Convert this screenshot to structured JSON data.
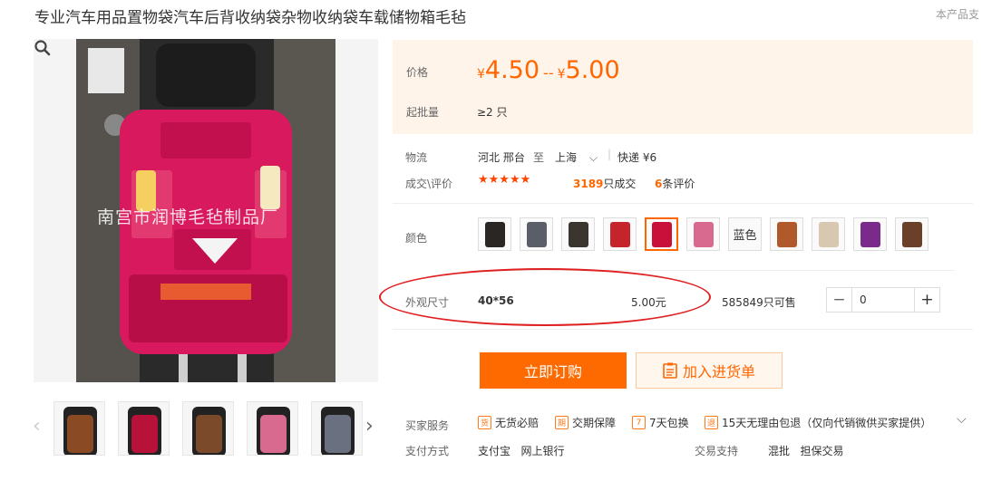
{
  "title": "专业汽车用品置物袋汽车后背收纳袋杂物收纳袋车载储物箱毛毡",
  "top_right_text": "本产品支",
  "main_image": {
    "watermark": "南宫市润博毛毡制品厂"
  },
  "price": {
    "label": "价格",
    "currency": "¥",
    "low": "4.50",
    "separator": "--",
    "high": "5.00"
  },
  "moq": {
    "label": "起批量",
    "value": "≥2 只"
  },
  "logistics": {
    "label": "物流",
    "from": "河北 邢台",
    "to_word": "至",
    "to": "上海",
    "express": "快递 ¥6"
  },
  "deals": {
    "label": "成交\\评价",
    "stars": "★★★★★",
    "deal_count": "3189",
    "deal_suffix": "只成交",
    "review_count": "6",
    "review_suffix": "条评价"
  },
  "color": {
    "label": "颜色",
    "text_option": "蓝色",
    "swatch_colors": [
      "#2a2623",
      "#5a5e68",
      "#3b3530",
      "#c6242c",
      "#c8103a",
      "#d86a90",
      "#b05a2c",
      "#d8c8b0",
      "#7a2a8a",
      "#6a4028"
    ]
  },
  "size": {
    "label": "外观尺寸",
    "value": "40*56",
    "price": "5.00元",
    "stock": "585849只可售",
    "quantity": "0"
  },
  "buttons": {
    "buy": "立即订购",
    "cart": "加入进货单"
  },
  "services": {
    "label": "买家服务",
    "items": [
      {
        "icon": "货",
        "text": "无货必赔"
      },
      {
        "icon": "期",
        "text": "交期保障"
      },
      {
        "icon": "7",
        "text": "7天包换"
      },
      {
        "icon": "退",
        "text": "15天无理由包退（仅向代销微供买家提供）"
      }
    ]
  },
  "payment": {
    "label": "支付方式",
    "methods": "支付宝   网上银行",
    "trade_label": "交易支持",
    "trade_values": "混批   担保交易"
  },
  "thumbnail_colors": [
    "#8a4a24",
    "#b8123a",
    "#7a4a2a",
    "#d86a90",
    "#6a7080"
  ]
}
